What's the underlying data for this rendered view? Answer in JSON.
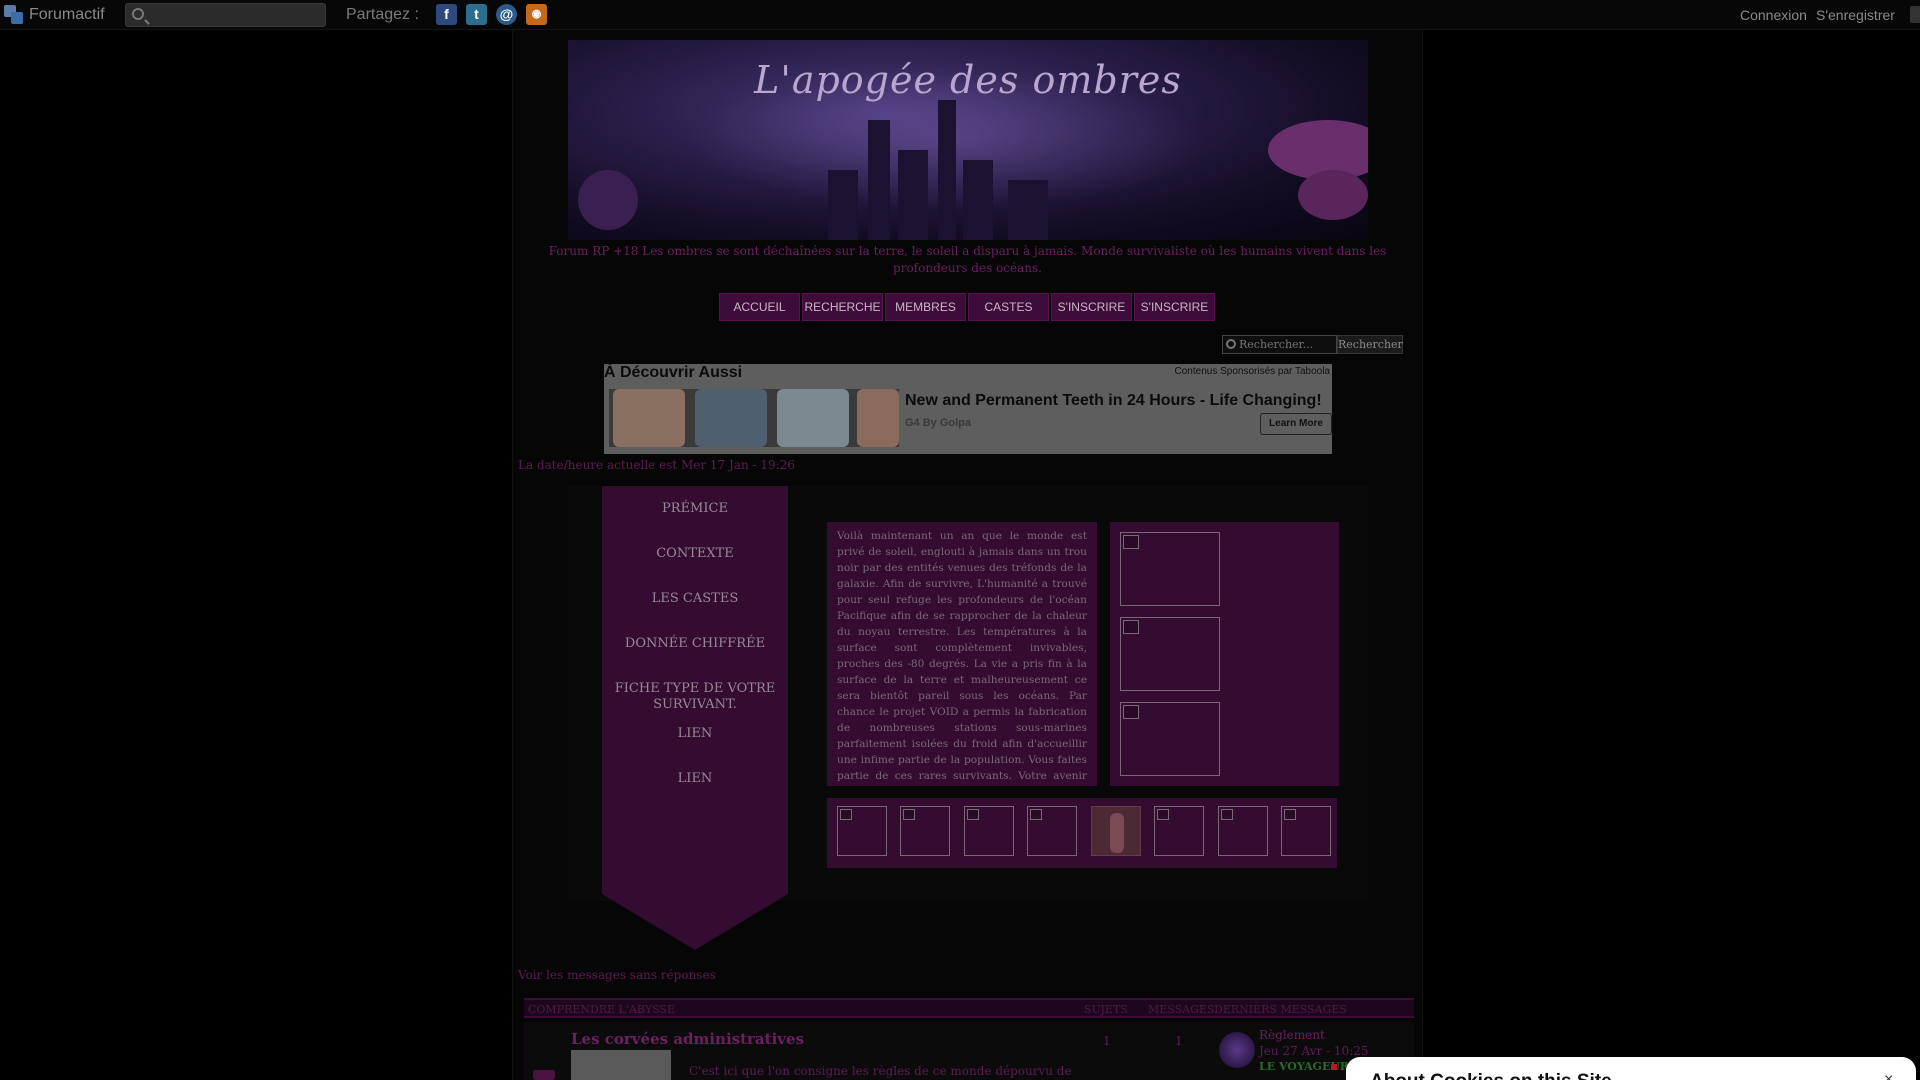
{
  "topbar": {
    "brand": "Forumactif",
    "search_placeholder": "",
    "share_label": "Partagez :",
    "share_icons": [
      "facebook-icon",
      "twitter-icon",
      "email-icon",
      "rss-icon"
    ],
    "connexion": "Connexion",
    "register": "S'enregistrer"
  },
  "banner": {
    "title": "L'apogée des ombres"
  },
  "tagline": "Forum RP +18 Les ombres se sont déchaînées sur la terre, le soleil a disparu à jamais. Monde survivaliste où les humains vivent dans les profondeurs des océans.",
  "nav": {
    "items": [
      "ACCUEIL",
      "RECHERCHE",
      "MEMBRES",
      "CASTES",
      "S'INSCRIRE",
      "S'INSCRIRE"
    ]
  },
  "forum_search": {
    "placeholder": "Rechercher...",
    "button": "Rechercher"
  },
  "ad": {
    "heading": "À Découvrir Aussi",
    "sponsor": "Contenus Sponsorisés par Taboola",
    "title": "New and Permanent Teeth in 24 Hours - Life Changing!",
    "source": "G4 By Golpa",
    "button": "Learn More"
  },
  "datetime": "La date/heure actuelle est Mer 17 Jan - 19:26",
  "widget": {
    "menu": [
      "PRÉMICE",
      "CONTEXTE",
      "LES CASTES",
      "DONNÉE CHIFFRÉE",
      "FICHE TYPE DE VOTRE SURVIVANT.",
      "LIEN",
      "LIEN"
    ],
    "story": "Voilà maintenant un an que le monde est privé de soleil, englouti à jamais dans un trou noir par des entités venues des tréfonds de la galaxie. Afin de survivre, L'humanité a trouvé pour seul refuge les profondeurs de l'océan Pacifique afin de se rapprocher de la chaleur du noyau terrestre. Les températures à la surface sont complètement invivables, proches des -80 degrés. La vie a pris fin à la surface de la terre et malheureusement ce sera bientôt pareil sous les océans. Par chance le projet VOID a permis la fabrication de nombreuses stations sous-marines parfaitement isolées du froid afin d'accueillir une infime partie de la population. Vous faites partie de ces rares survivants. Votre avenir dépend uniquement de la stabilité politique et structurelle des stations, et aussi au maintien"
  },
  "unanswered": "Voir les messages sans réponses",
  "category": {
    "name": "COMPRENDRE L'ABYSSE",
    "col_topics": "SUJETS",
    "col_messages": "MESSAGES",
    "col_last": "DERNIERS MESSAGES"
  },
  "forum": {
    "title": "Les corvées administratives",
    "description": "C'est ici que l'on consigne les règles de ce monde dépourvu de",
    "topics": "1",
    "messages": "1",
    "last_title": "Règlement",
    "last_date": "Jeu 27 Avr - 10:25",
    "last_user": "LE VOYAGEUR"
  },
  "cookie": {
    "title": "About Cookies on this Site",
    "close": "×"
  }
}
